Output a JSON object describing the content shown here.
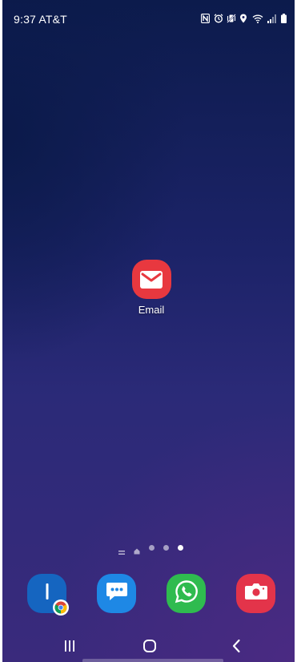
{
  "status_bar": {
    "time_carrier": "9:37 AT&T",
    "icons": [
      "nfc-icon",
      "alarm-icon",
      "vibrate-mute-icon",
      "location-icon",
      "wifi-icon",
      "signal-icon",
      "battery-icon"
    ]
  },
  "home": {
    "apps": [
      {
        "label": "Email",
        "icon": "email-icon",
        "color": "#e8383f"
      }
    ]
  },
  "pager": {
    "pages": 4,
    "active_index": 3
  },
  "dock": {
    "apps": [
      {
        "name": "internet",
        "icon": "internet-icon",
        "badge": "chrome-icon",
        "color": "#1565c0"
      },
      {
        "name": "messages",
        "icon": "messages-icon",
        "color": "#1e88e5"
      },
      {
        "name": "whatsapp",
        "icon": "whatsapp-icon",
        "color": "#2fbb4f"
      },
      {
        "name": "camera",
        "icon": "camera-icon",
        "color": "#e3344a"
      }
    ]
  },
  "navbar": {
    "buttons": [
      "recents-icon",
      "home-icon",
      "back-icon"
    ]
  }
}
